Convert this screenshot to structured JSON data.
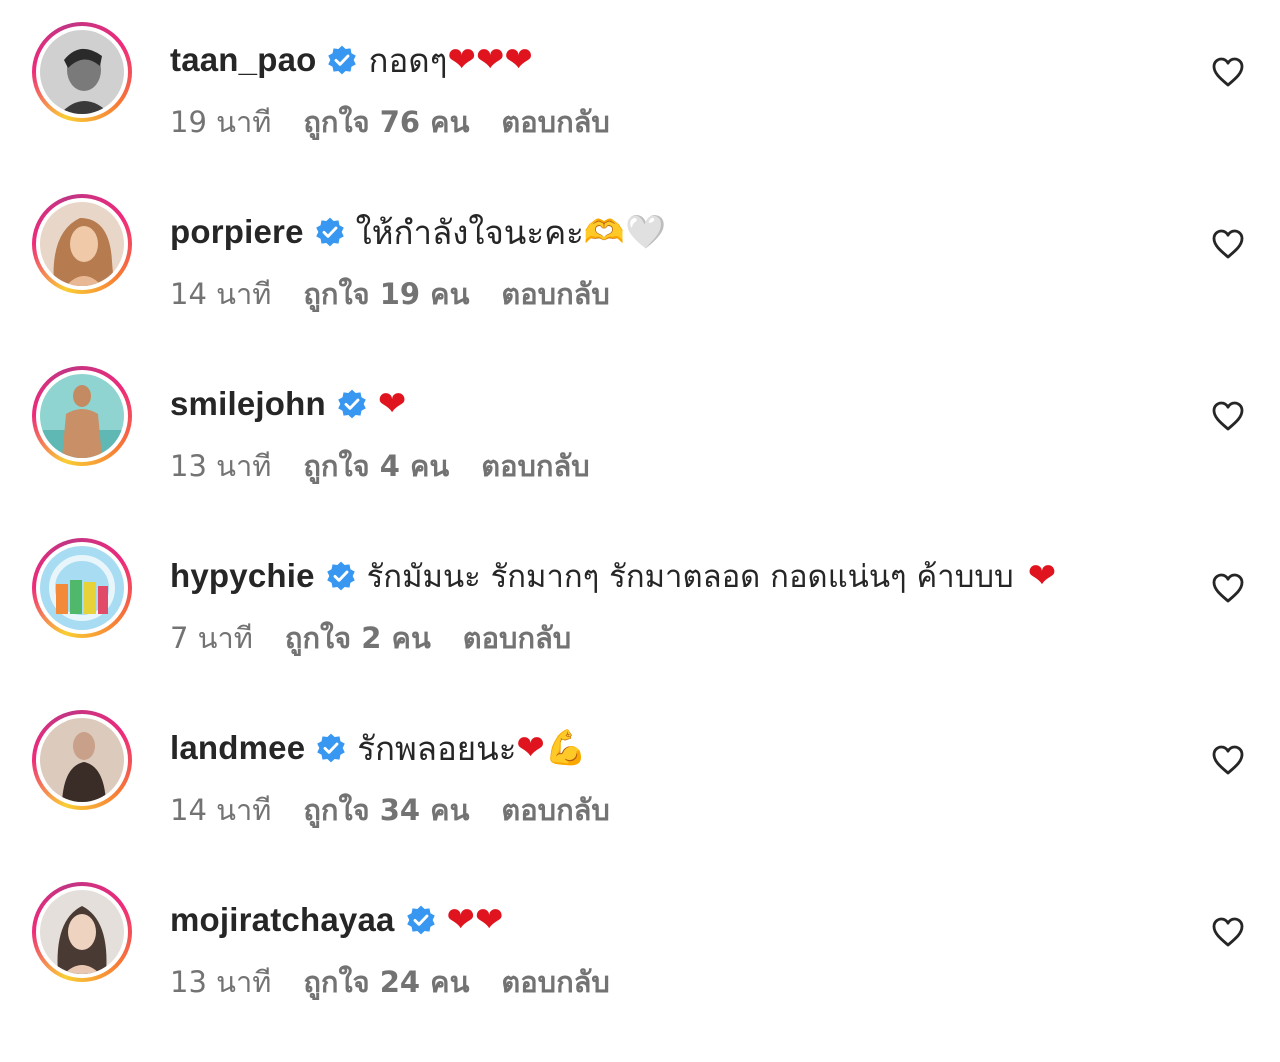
{
  "comments": [
    {
      "username": "taan_pao",
      "text": "กอดๆ",
      "emoji": "❤❤❤",
      "time": "19 นาที",
      "likes": "ถูกใจ 76 คน",
      "reply": "ตอบกลับ",
      "avatar_color": "#9a9a9a"
    },
    {
      "username": "porpiere",
      "text": "ให้กำลังใจนะคะ",
      "emoji": "🫶🤍",
      "time": "14 นาที",
      "likes": "ถูกใจ 19 คน",
      "reply": "ตอบกลับ",
      "avatar_color": "#d9a27a"
    },
    {
      "username": "smilejohn",
      "text": "",
      "emoji": "❤",
      "time": "13 นาที",
      "likes": "ถูกใจ 4 คน",
      "reply": "ตอบกลับ",
      "avatar_color": "#7cc6c4"
    },
    {
      "username": "hypychie",
      "text": "รักมัมนะ รักมากๆ รักมาตลอด กอดแน่นๆ ค้าบบบ",
      "emoji": "❤",
      "time": "7 นาที",
      "likes": "ถูกใจ 2 คน",
      "reply": "ตอบกลับ",
      "avatar_color": "#7fc4e8"
    },
    {
      "username": "landmee",
      "text": "รักพลอยนะ",
      "emoji": "❤💪",
      "time": "14 นาที",
      "likes": "ถูกใจ 34 คน",
      "reply": "ตอบกลับ",
      "avatar_color": "#b99a86"
    },
    {
      "username": "mojiratchayaa",
      "text": "",
      "emoji": "❤❤",
      "time": "13 นาที",
      "likes": "ถูกใจ 24 คน",
      "reply": "ตอบกลับ",
      "avatar_color": "#c8c2bc"
    }
  ],
  "colors": {
    "verified": "#3897f0",
    "heart": "#e0141e",
    "meta_text": "#737373",
    "primary_text": "#262626"
  }
}
